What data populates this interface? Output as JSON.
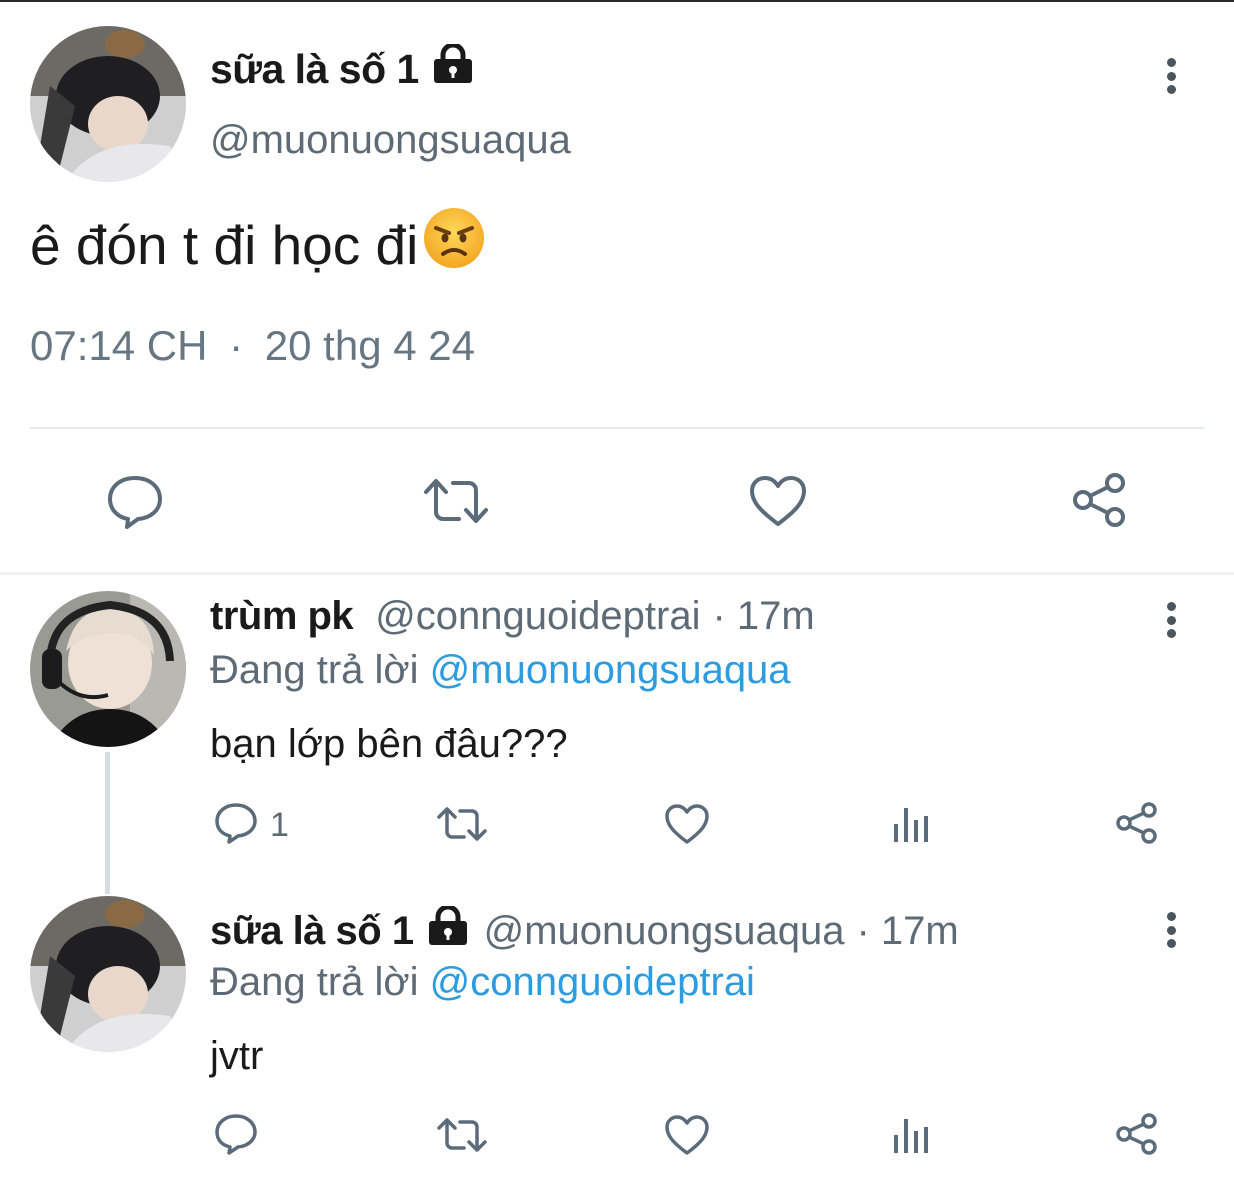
{
  "main_tweet": {
    "display_name": "sữa là số 1",
    "handle": "@muonuongsuaqua",
    "text": "ê đón t đi học đi",
    "time": "07:14 CH",
    "separator": "·",
    "date": "20 thg 4 24",
    "actions": [
      "reply-icon",
      "retweet-icon",
      "like-icon",
      "share-icon"
    ]
  },
  "replies": [
    {
      "display_name": "trùm pk",
      "handle": "@connguoideptrai",
      "sep_time": "· 17m",
      "replying_label": "Đang trả lời",
      "replying_to": "@muonuongsuaqua",
      "text": "bạn lớp bên đâu???",
      "reply_count": "1"
    },
    {
      "display_name": "sữa là số 1",
      "handle": "@muonuongsuaqua",
      "sep_time": "· 17m",
      "replying_label": "Đang trả lời",
      "replying_to": "@connguoideptrai",
      "text": "jvtr",
      "reply_count": ""
    }
  ],
  "colors": {
    "text": "#1a1a1a",
    "secondary": "#5e6b76",
    "link": "#2c9be0",
    "icon": "#5b6b7a",
    "divider": "#e6ecf0"
  }
}
